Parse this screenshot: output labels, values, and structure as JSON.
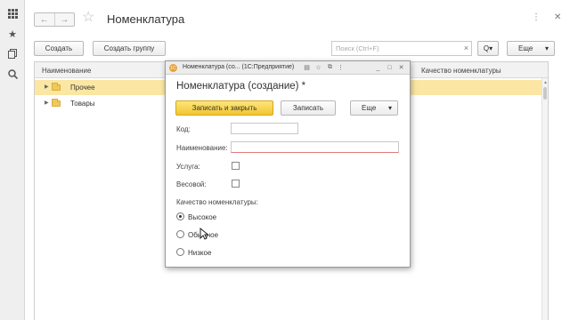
{
  "header": {
    "title": "Номенклатура",
    "nav_back": "←",
    "nav_forward": "→"
  },
  "toolbar": {
    "create": "Создать",
    "create_group": "Создать группу",
    "search_placeholder": "Поиск (Ctrl+F)",
    "search_clear": "×",
    "search_btn": "Q▾",
    "more": "Еще",
    "more_arrow": "▾"
  },
  "table": {
    "columns": [
      "Наименование",
      "Качество номенклатуры"
    ],
    "rows": [
      {
        "label": "Прочее",
        "selected": true
      },
      {
        "label": "Товары",
        "selected": false
      }
    ]
  },
  "dialog": {
    "window_title": "Номенклатура (со...  (1С:Предприятие)",
    "heading": "Номенклатура (создание) *",
    "buttons": {
      "save_close": "Записать и закрыть",
      "save": "Записать",
      "more": "Еще",
      "more_arrow": "▾"
    },
    "fields": {
      "code_label": "Код:",
      "code_value": "",
      "name_label": "Наименование:",
      "name_value": "",
      "service_label": "Услуга:",
      "weight_label": "Весовой:",
      "quality_label": "Качество номенклатуры:"
    },
    "quality_options": [
      {
        "label": "Высокое",
        "checked": true
      },
      {
        "label": "Обычное",
        "checked": false
      },
      {
        "label": "Низкое",
        "checked": false
      }
    ]
  },
  "colors": {
    "accent_yellow": "#f2c531",
    "selection": "#fbe7a3"
  }
}
